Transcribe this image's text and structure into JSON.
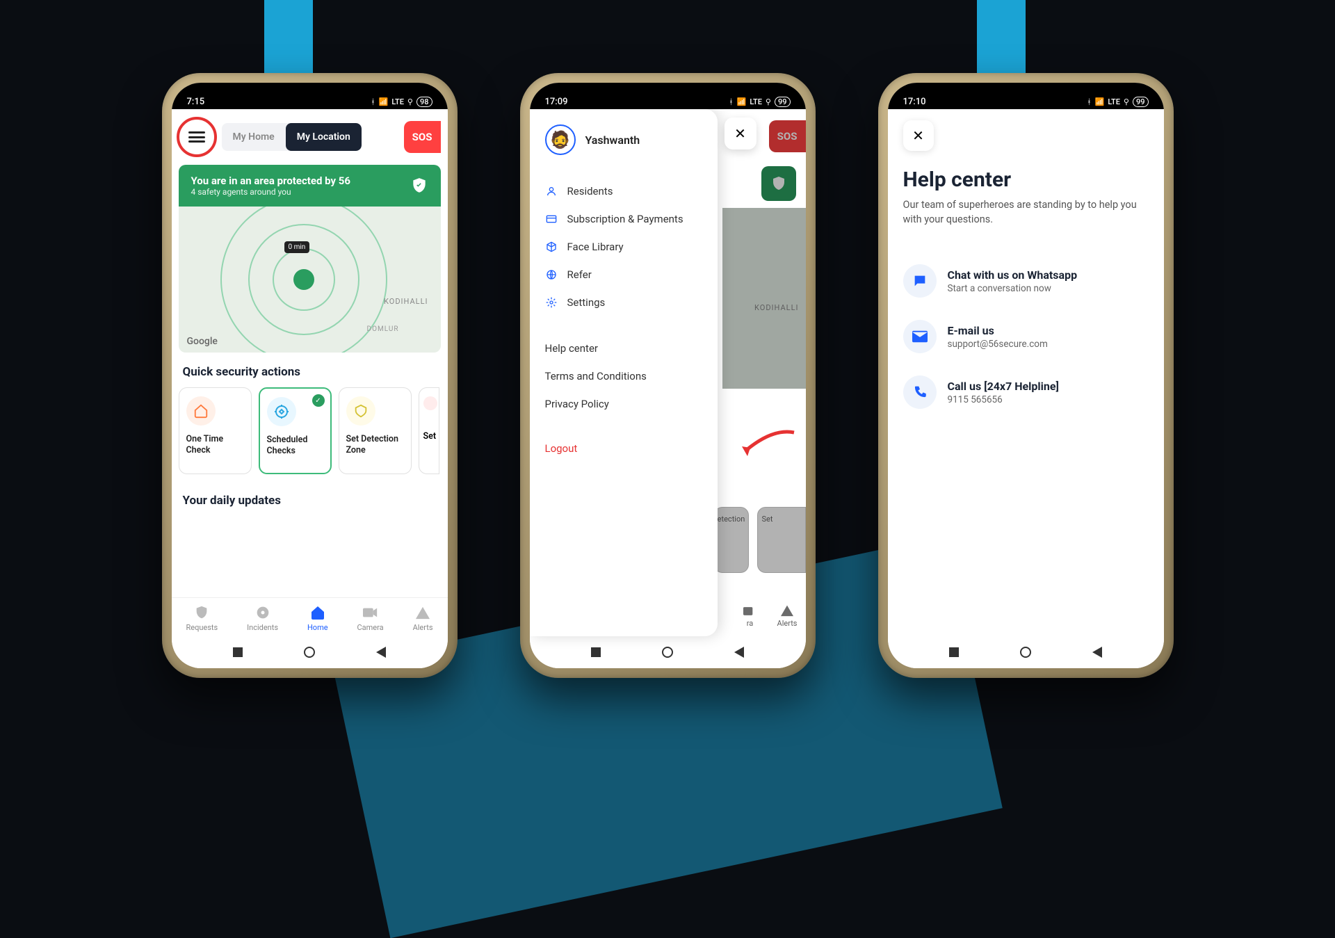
{
  "phone1": {
    "time": "7:15",
    "toggle": {
      "home": "My Home",
      "location": "My Location"
    },
    "sos": "SOS",
    "banner": {
      "title": "You are in an area protected by 56",
      "sub": "4 safety agents around you"
    },
    "map": {
      "tag": "0 min",
      "place1": "KODIHALLI",
      "place2": "DOMLUR",
      "attrib": "Google"
    },
    "section1": "Quick security actions",
    "actions": [
      {
        "label": "One Time Check"
      },
      {
        "label": "Scheduled Checks"
      },
      {
        "label": "Set Detection Zone"
      },
      {
        "label": "Set"
      }
    ],
    "section2": "Your daily updates",
    "nav": [
      "Requests",
      "Incidents",
      "Home",
      "Camera",
      "Alerts"
    ]
  },
  "phone2": {
    "time": "17:09",
    "user": "Yashwanth",
    "menu": [
      "Residents",
      "Subscription & Payments",
      "Face Library",
      "Refer",
      "Settings"
    ],
    "submenu": [
      "Help center",
      "Terms and Conditions",
      "Privacy Policy"
    ],
    "logout": "Logout",
    "sos": "SOS",
    "bgcard1": "etection",
    "bgcard2": "Set",
    "bgnav1": "ra",
    "bgnav2": "Alerts",
    "mapplace": "KODIHALLI"
  },
  "phone3": {
    "time": "17:10",
    "title": "Help center",
    "sub": "Our team of superheroes are standing by to help you with your questions.",
    "rows": [
      {
        "t1": "Chat with us on Whatsapp",
        "t2": "Start a conversation now"
      },
      {
        "t1": "E-mail us",
        "t2": "support@56secure.com"
      },
      {
        "t1": "Call us [24x7 Helpline]",
        "t2": "9115 565656"
      }
    ]
  },
  "statusicons": {
    "battery": "98"
  }
}
